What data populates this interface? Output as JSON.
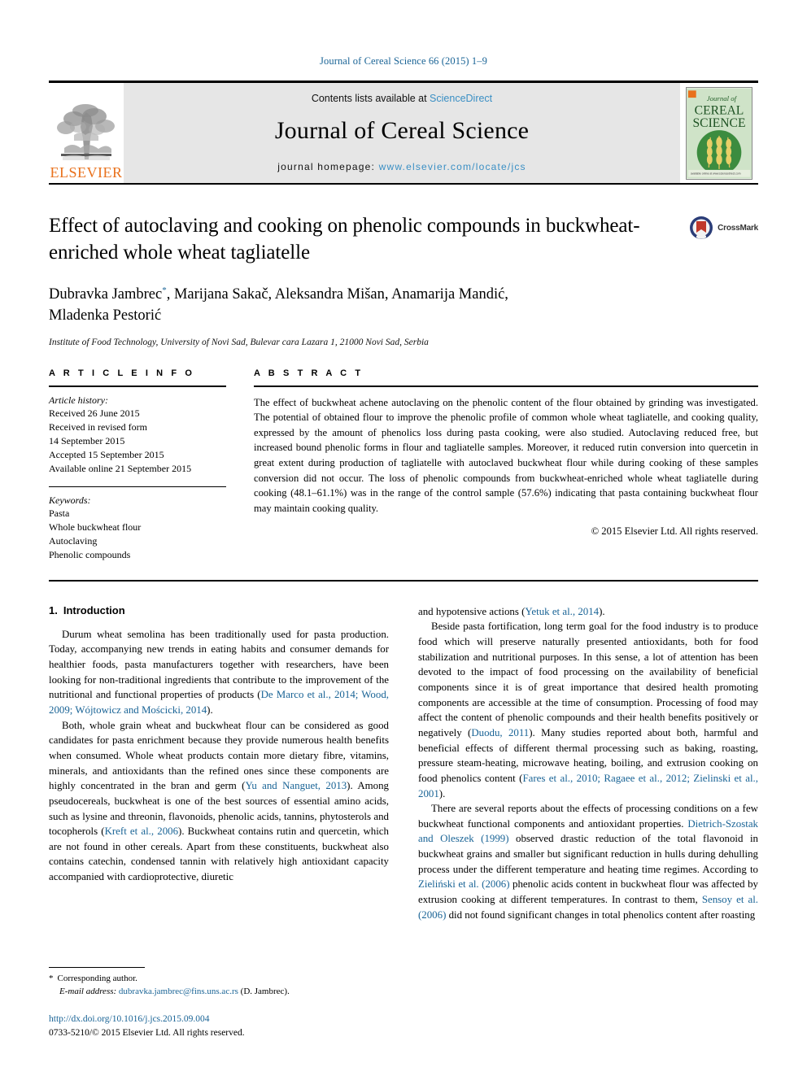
{
  "running_head": "Journal of Cereal Science 66 (2015) 1–9",
  "masthead": {
    "publisher_name": "ELSEVIER",
    "contents_prefix": "Contents lists available at ",
    "contents_link": "ScienceDirect",
    "journal_title": "Journal of Cereal Science",
    "homepage_prefix": "journal homepage: ",
    "homepage_url": "www.elsevier.com/locate/jcs",
    "cover_title_line1": "Journal of",
    "cover_title_line2": "CEREAL",
    "cover_title_line3": "SCIENCE"
  },
  "crossmark": {
    "label": "CrossMark"
  },
  "article": {
    "title": "Effect of autoclaving and cooking on phenolic compounds in buckwheat-enriched whole wheat tagliatelle",
    "authors_line1": "Dubravka Jambrec",
    "authors_marker": "*",
    "authors_line1_rest": ", Marijana Sakač, Aleksandra Mišan, Anamarija Mandić,",
    "authors_line2": "Mladenka Pestorić",
    "affiliation": "Institute of Food Technology, University of Novi Sad, Bulevar cara Lazara 1, 21000 Novi Sad, Serbia"
  },
  "article_info": {
    "label": "A R T I C L E   I N F O",
    "history_label": "Article history:",
    "history": [
      "Received 26 June 2015",
      "Received in revised form",
      "14 September 2015",
      "Accepted 15 September 2015",
      "Available online 21 September 2015"
    ],
    "keywords_label": "Keywords:",
    "keywords": [
      "Pasta",
      "Whole buckwheat flour",
      "Autoclaving",
      "Phenolic compounds"
    ]
  },
  "abstract": {
    "label": "A B S T R A C T",
    "text": "The effect of buckwheat achene autoclaving on the phenolic content of the flour obtained by grinding was investigated. The potential of obtained flour to improve the phenolic profile of common whole wheat tagliatelle, and cooking quality, expressed by the amount of phenolics loss during pasta cooking, were also studied. Autoclaving reduced free, but increased bound phenolic forms in flour and tagliatelle samples. Moreover, it reduced rutin conversion into quercetin in great extent during production of tagliatelle with autoclaved buckwheat flour while during cooking of these samples conversion did not occur. The loss of phenolic compounds from buckwheat-enriched whole wheat tagliatelle during cooking (48.1–61.1%) was in the range of the control sample (57.6%) indicating that pasta containing buckwheat flour may maintain cooking quality.",
    "copyright": "© 2015 Elsevier Ltd. All rights reserved."
  },
  "introduction": {
    "number": "1.",
    "heading": "Introduction",
    "left_paragraphs": [
      {
        "parts": [
          {
            "t": "Durum wheat semolina has been traditionally used for pasta production. Today, accompanying new trends in eating habits and consumer demands for healthier foods, pasta manufacturers together with researchers, have been looking for non-traditional ingredients that contribute to the improvement of the nutritional and functional properties of products (",
            "cite": false
          },
          {
            "t": "De Marco et al., 2014; Wood, 2009; Wójtowicz and Mościcki, 2014",
            "cite": true
          },
          {
            "t": ").",
            "cite": false
          }
        ]
      },
      {
        "parts": [
          {
            "t": "Both, whole grain wheat and buckwheat flour can be considered as good candidates for pasta enrichment because they provide numerous health benefits when consumed. Whole wheat products contain more dietary fibre, vitamins, minerals, and antioxidants than the refined ones since these components are highly concentrated in the bran and germ (",
            "cite": false
          },
          {
            "t": "Yu and Nanguet, 2013",
            "cite": true
          },
          {
            "t": "). Among pseudocereals, buckwheat is one of the best sources of essential amino acids, such as lysine and threonin, flavonoids, phenolic acids, tannins, phytosterols and tocopherols (",
            "cite": false
          },
          {
            "t": "Kreft et al., 2006",
            "cite": true
          },
          {
            "t": "). Buckwheat contains rutin and quercetin, which are not found in other cereals. Apart from these constituents, buckwheat also contains catechin, condensed tannin with relatively high antioxidant capacity accompanied with cardioprotective, diuretic",
            "cite": false
          }
        ]
      }
    ],
    "right_paragraphs": [
      {
        "noindent": true,
        "parts": [
          {
            "t": "and hypotensive actions (",
            "cite": false
          },
          {
            "t": "Yetuk et al., 2014",
            "cite": true
          },
          {
            "t": ").",
            "cite": false
          }
        ]
      },
      {
        "parts": [
          {
            "t": "Beside pasta fortification, long term goal for the food industry is to produce food which will preserve naturally presented antioxidants, both for food stabilization and nutritional purposes. In this sense, a lot of attention has been devoted to the impact of food processing on the availability of beneficial components since it is of great importance that desired health promoting components are accessible at the time of consumption. Processing of food may affect the content of phenolic compounds and their health benefits positively or negatively (",
            "cite": false
          },
          {
            "t": "Duodu, 2011",
            "cite": true
          },
          {
            "t": "). Many studies reported about both, harmful and beneficial effects of different thermal processing such as baking, roasting, pressure steam-heating, microwave heating, boiling, and extrusion cooking on food phenolics content (",
            "cite": false
          },
          {
            "t": "Fares et al., 2010; Ragaee et al., 2012; Zielinski et al., 2001",
            "cite": true
          },
          {
            "t": ").",
            "cite": false
          }
        ]
      },
      {
        "parts": [
          {
            "t": "There are several reports about the effects of processing conditions on a few buckwheat functional components and antioxidant properties. ",
            "cite": false
          },
          {
            "t": "Dietrich-Szostak and Oleszek (1999)",
            "cite": true
          },
          {
            "t": " observed drastic reduction of the total flavonoid in buckwheat grains and smaller but significant reduction in hulls during dehulling process under the different temperature and heating time regimes. According to ",
            "cite": false
          },
          {
            "t": "Zieliński et al. (2006)",
            "cite": true
          },
          {
            "t": " phenolic acids content in buckwheat flour was affected by extrusion cooking at different temperatures. In contrast to them, ",
            "cite": false
          },
          {
            "t": "Sensoy et al. (2006)",
            "cite": true
          },
          {
            "t": " did not found significant changes in total phenolics content after roasting",
            "cite": false
          }
        ]
      }
    ]
  },
  "footnote": {
    "star": "*",
    "corresponding": "Corresponding author.",
    "email_label": "E-mail address:",
    "email": "dubravka.jambrec@fins.uns.ac.rs",
    "email_suffix": "(D. Jambrec)."
  },
  "footer": {
    "doi": "http://dx.doi.org/10.1016/j.jcs.2015.09.004",
    "issn": "0733-5210/© 2015 Elsevier Ltd. All rights reserved."
  },
  "colors": {
    "link_blue": "#1a6496",
    "sciencedirect_blue": "#3a8fc4",
    "elsevier_orange": "#E9711C",
    "masthead_gray": "#e6e6e6",
    "cover_green": "#2e7d32"
  }
}
